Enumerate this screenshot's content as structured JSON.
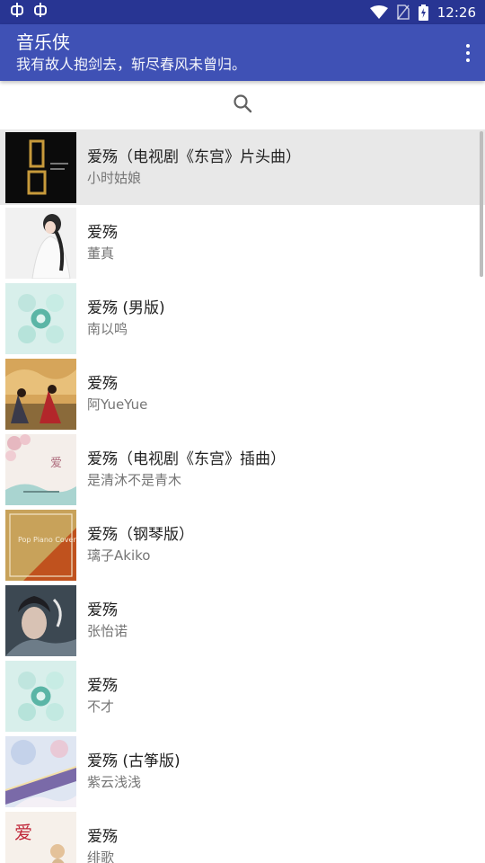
{
  "status_bar": {
    "left_icons": [
      "bug-icon",
      "bug-icon"
    ],
    "time": "12:26"
  },
  "app_bar": {
    "title": "音乐侠",
    "subtitle": "我有故人抱剑去，斩尽春风未曾归。"
  },
  "search": {
    "icon": "search-icon"
  },
  "songs": [
    {
      "title": "爱殇（电视剧《东宫》片头曲）",
      "artist": "小时姑娘",
      "selected": true
    },
    {
      "title": "爱殇",
      "artist": "董真"
    },
    {
      "title": "爱殇 (男版)",
      "artist": "南以鸣"
    },
    {
      "title": "爱殇",
      "artist": "阿YueYue"
    },
    {
      "title": "爱殇（电视剧《东宫》插曲）",
      "artist": "是清沐不是青木"
    },
    {
      "title": "爱殇（钢琴版）",
      "artist": "璃子Akiko",
      "cover_text": "Pop Piano Cover"
    },
    {
      "title": "爱殇",
      "artist": "张怡诺"
    },
    {
      "title": "爱殇",
      "artist": "不才"
    },
    {
      "title": "爱殇 (古筝版)",
      "artist": "紫云浅浅"
    },
    {
      "title": "爱殇",
      "artist": "绯歌"
    }
  ],
  "colors": {
    "status_bar": "#283593",
    "app_bar": "#3f51b5",
    "selected_row": "#e8e8e8"
  }
}
